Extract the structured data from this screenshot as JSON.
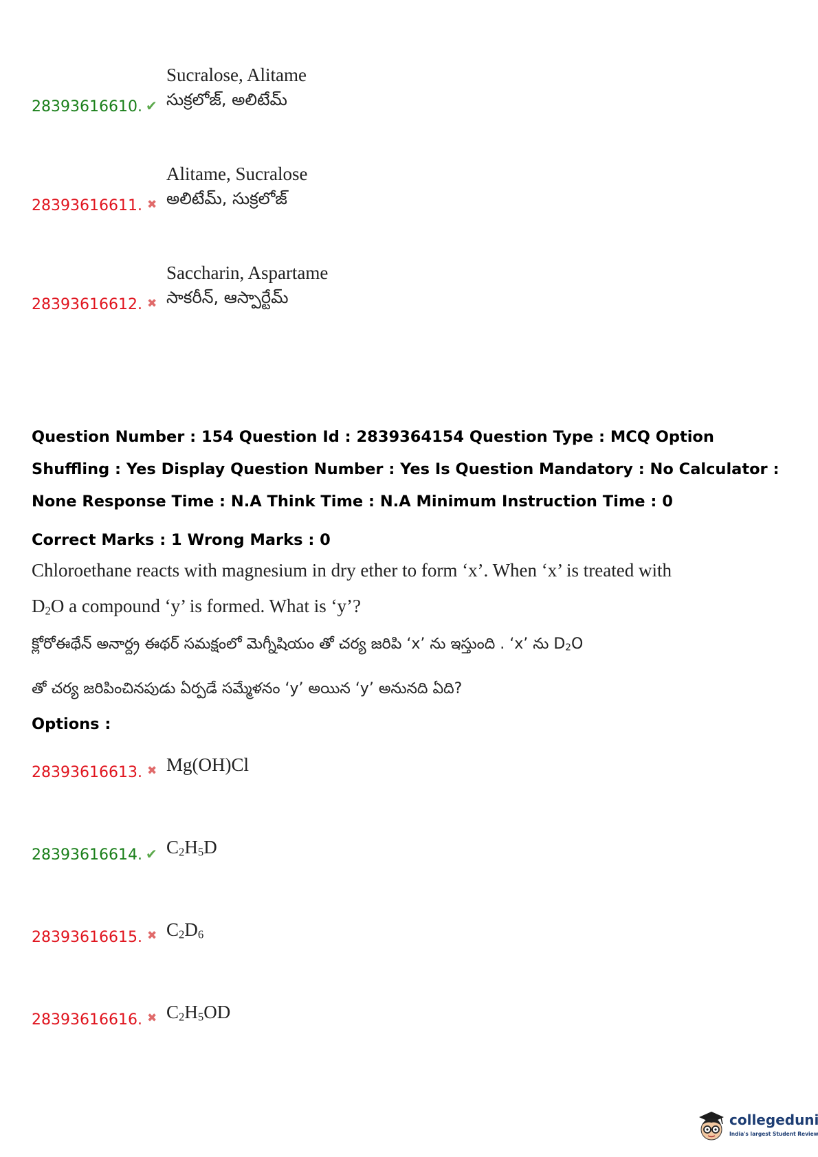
{
  "prev_options": [
    {
      "number": "28393616610.",
      "status": "correct",
      "english": "Sucralose, Alitame",
      "telugu": "సుక్రలోజ్, అలిటేమ్"
    },
    {
      "number": "28393616611.",
      "status": "wrong",
      "english": "Alitame, Sucralose",
      "telugu": "అలిటేమ్, సుక్రలోజ్"
    },
    {
      "number": "28393616612.",
      "status": "wrong",
      "english": "Saccharin, Aspartame",
      "telugu": "సాకరీన్, ఆస్పార్టేమ్"
    }
  ],
  "question": {
    "meta": "Question Number : 154 Question Id : 2839364154 Question Type : MCQ Option Shuffling : Yes Display Question Number : Yes Is Question Mandatory : No Calculator : None Response Time : N.A Think Time : N.A Minimum Instruction Time : 0",
    "marks": "Correct Marks : 1 Wrong Marks : 0",
    "text_en_1": "Chloroethane reacts with magnesium in dry ether to form ‘x’. When ‘x’ is treated with",
    "text_en_2a": "D",
    "text_en_2sub": "2",
    "text_en_2b": "O a compound ‘y’ is formed. What is ‘y’?",
    "text_te_1a": "క్లోరోఈథేన్ అనార్ద్ర ఈథర్ సమక్షంలో మెగ్నీషియం తో చర్య జరిపి ‘x’ ను ఇస్తుంది . ‘x’ ను D",
    "text_te_1sub": "2",
    "text_te_1b": "O",
    "text_te_2": "తో చర్య జరిపించినపుడు ఏర్పడే సమ్మేళనం ‘y’ అయిన ‘y’ అనునది ఏది?",
    "options_label": "Options :"
  },
  "options": [
    {
      "number": "28393616613.",
      "status": "wrong",
      "parts": [
        "Mg(OH)Cl"
      ]
    },
    {
      "number": "28393616614.",
      "status": "correct",
      "parts": [
        "C",
        "2",
        "H",
        "5",
        "D"
      ]
    },
    {
      "number": "28393616615.",
      "status": "wrong",
      "parts": [
        "C",
        "2",
        "D",
        "6"
      ]
    },
    {
      "number": "28393616616.",
      "status": "wrong",
      "parts": [
        "C",
        "2",
        "H",
        "5",
        "OD"
      ]
    }
  ],
  "icons": {
    "correct": "check-icon",
    "wrong": "cross-icon",
    "correct_color": "#1a7f1a",
    "wrong_color": "#e0141e"
  },
  "logo": {
    "name": "collegedunia",
    "tagline": "India's largest Student Review Platform"
  }
}
